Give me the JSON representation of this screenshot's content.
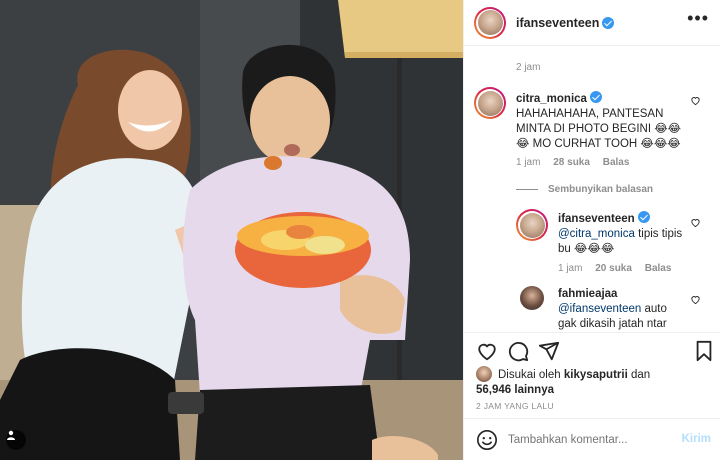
{
  "post": {
    "author": "ifanseventeen",
    "posted_ago": "2 jam",
    "posted_time_caps": "2 JAM YANG LALU"
  },
  "comments": [
    {
      "user": "citra_monica",
      "verified": true,
      "text": "HAHAHAHAHA, PANTESAN MINTA DI PHOTO BEGINI 😂😂😂 MO CURHAT TOOH 😂😂😂",
      "time": "1 jam",
      "likes": "28 suka",
      "reply_label": "Balas"
    }
  ],
  "hide_replies_label": "Sembunyikan balasan",
  "replies": [
    {
      "user": "ifanseventeen",
      "verified": true,
      "mention": "@citra_monica",
      "text": "tipis tipis bu 😂😂😂",
      "time": "1 jam",
      "likes": "20 suka",
      "reply_label": "Balas"
    },
    {
      "user": "fahmieajaa",
      "verified": false,
      "mention": "@ifanseventeen",
      "text": "auto gak dikasih jatah ntar"
    }
  ],
  "likes": {
    "prefix": "Disukai oleh",
    "user": "kikysaputrii",
    "conj": "dan",
    "count": "56,946 lainnya"
  },
  "add_comment": {
    "placeholder": "Tambahkan komentar...",
    "submit_label": "Kirim"
  },
  "icons": {
    "like": "heart-outline-icon",
    "comment": "comment-bubble-icon",
    "share": "paper-plane-icon",
    "save": "bookmark-icon",
    "emoji": "smiley-icon",
    "more": "ellipsis-icon",
    "tag": "person-tag-icon"
  },
  "colors": {
    "verified": "#3897f0",
    "mention": "#00376b",
    "submit_disabled": "#b2dffc",
    "muted": "#8e8e8e"
  }
}
